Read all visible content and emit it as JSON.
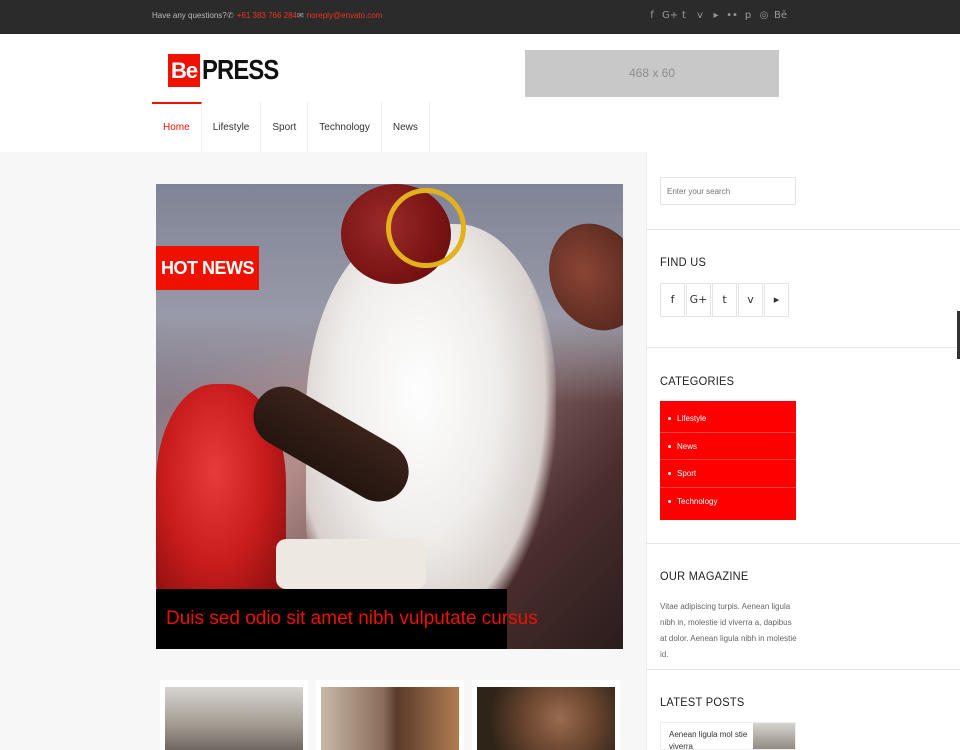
{
  "topbar": {
    "question": "Have any questions?",
    "phone": "+61 383 766 284",
    "email": "noreply@envato.com",
    "social_icons": [
      "facebook-icon",
      "google-plus-icon",
      "twitter-icon",
      "vimeo-icon",
      "youtube-icon",
      "flickr-icon",
      "pinterest-icon",
      "instagram-icon",
      "behance-icon"
    ],
    "social_glyphs": [
      "f",
      "G+",
      "t",
      "v",
      "▸",
      "••",
      "p",
      "◎",
      "Bē"
    ]
  },
  "header": {
    "logo_be": "Be",
    "logo_press": "PRESS",
    "ad_text": "468 x 60"
  },
  "nav": {
    "items": [
      "Home",
      "Lifestyle",
      "Sport",
      "Technology",
      "News"
    ]
  },
  "hero": {
    "badge": "HOT NEWS",
    "headline": "Duis sed odio sit amet nibh vulputate cursus"
  },
  "sidebar": {
    "search_placeholder": "Enter your search",
    "find_us_title": "FIND US",
    "find_us_icons": [
      "facebook-icon",
      "google-plus-icon",
      "twitter-icon",
      "vimeo-icon",
      "youtube-icon"
    ],
    "find_us_glyphs": [
      "f",
      "G+",
      "t",
      "v",
      "▸"
    ],
    "categories_title": "CATEGORIES",
    "categories": [
      "Lifestyle",
      "News",
      "Sport",
      "Technology"
    ],
    "magazine_title": "OUR MAGAZINE",
    "magazine_text": "Vitae adipiscing turpis. Aenean ligula nibh in, molestie id viverra a, dapibus at dolor. Aenean ligula nibh in molestie id.",
    "latest_title": "LATEST POSTS",
    "latest_post": "Aenean ligula mol stie viverra"
  },
  "colors": {
    "accent": "#ee1111",
    "topbar_bg": "#2b2b2b"
  }
}
